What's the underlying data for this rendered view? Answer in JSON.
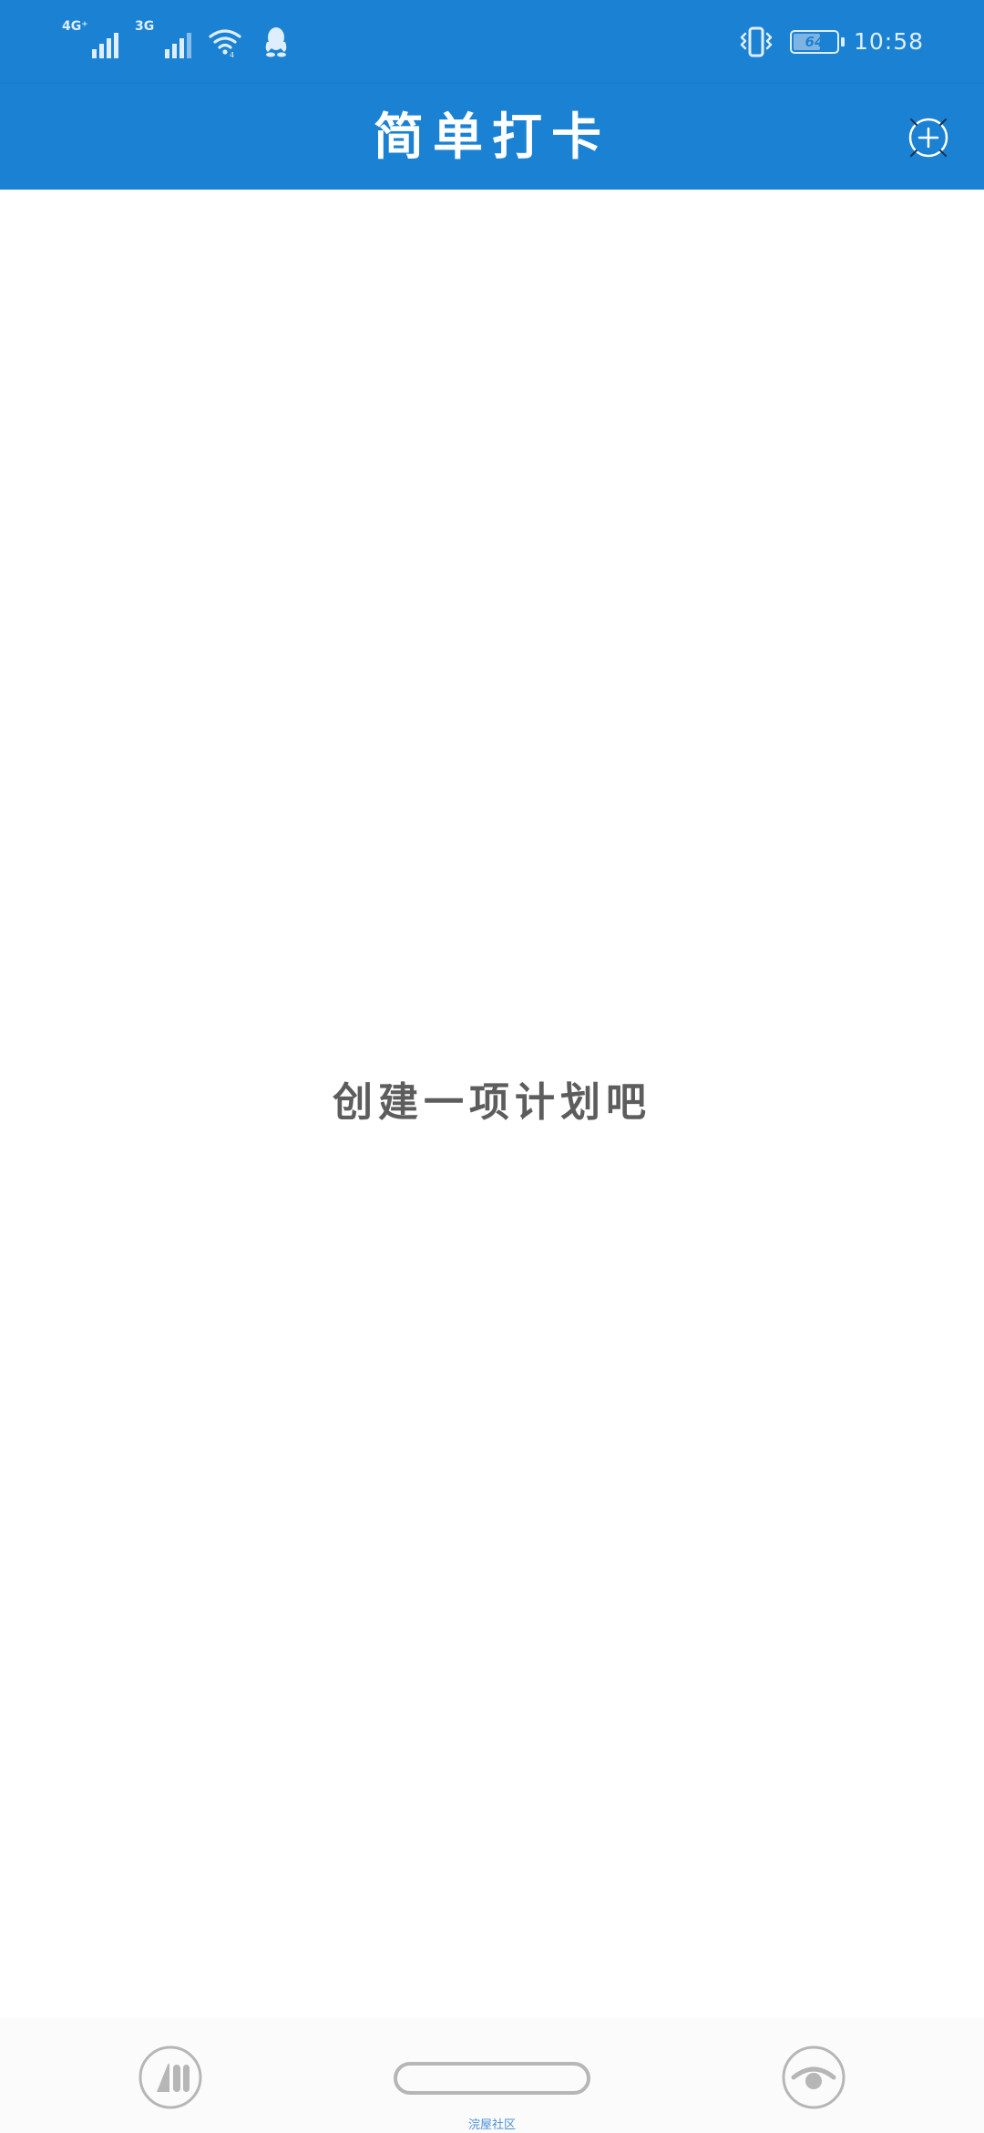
{
  "status_bar": {
    "network_1": "4G⁺",
    "network_2": "3G",
    "battery": {
      "level": 64,
      "level_label": "64"
    },
    "time": "10:58",
    "icons": {
      "wifi": "wifi-icon",
      "qq": "qq-icon",
      "vibrate": "vibrate-icon"
    }
  },
  "app_bar": {
    "title": "简单打卡",
    "add_icon": "plus-circle-icon"
  },
  "content": {
    "empty_hint": "创建一项计划吧"
  },
  "bottom_nav": {
    "left_icon": "app-logo-icon",
    "home_icon": "home-pill-icon",
    "right_icon": "eye-icon",
    "caption": "浣屋社区"
  },
  "colors": {
    "primary": "#1b82d3",
    "status_text": "#dfeeff",
    "title_text": "#ffffff",
    "hint_text": "#5d5d5d",
    "nav_icon": "#b6b6b6",
    "background": "#ffffff"
  }
}
